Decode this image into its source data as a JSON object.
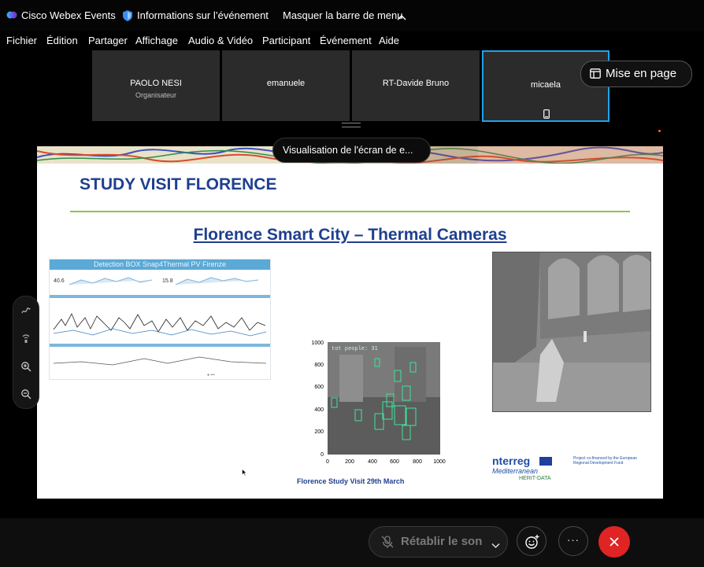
{
  "titlebar": {
    "app_name": "Cisco Webex Events",
    "event_info": "Informations sur l’événement",
    "hide_menu": "Masquer la barre de menu",
    "chevron": "^"
  },
  "menu": [
    "Fichier",
    "Édition",
    "Partager",
    "Affichage",
    "Audio & Vidéo",
    "Participant",
    "Événement",
    "Aide"
  ],
  "participants": [
    {
      "name": "PAOLO NESI",
      "role": "Organisateur"
    },
    {
      "name": "emanuele",
      "role": ""
    },
    {
      "name": "RT-Davide Bruno",
      "role": ""
    },
    {
      "name": "micaela",
      "role": ""
    }
  ],
  "layout_button": "Mise en page",
  "share_label": "Visualisation de l'écran de e...",
  "slide": {
    "title": "STUDY VISIT FLORENCE",
    "subtitle": "Florence Smart City – Thermal Cameras",
    "dashboard": {
      "title": "Detection BOX Snap4Thermal PV Firenze",
      "value_left": "40.6",
      "value_right": "15.8"
    },
    "thermal_plot": {
      "overlay_text": "tot people: 31",
      "y_ticks": [
        "1000",
        "800",
        "600",
        "400",
        "200",
        "0"
      ],
      "x_ticks": [
        "0",
        "200",
        "400",
        "600",
        "800",
        "1000"
      ]
    },
    "footer_text": "Florence Study Visit  29th March",
    "logo_text_1": "nterreg",
    "logo_text_2": "Mediterranean",
    "logo_text_3": "HERIT-DATA",
    "cofinanced_text": "Project co-financed by the European Regional Development Fund"
  },
  "controls": {
    "mute_label": "Rétablir le son",
    "more_label": "···"
  },
  "colors": {
    "accent_blue": "#1aa3e8",
    "end_red": "#e02424",
    "slide_title_navy": "#1f3f8f",
    "rule_green": "#8dc63f",
    "plot_box_green": "#3ee39a"
  }
}
